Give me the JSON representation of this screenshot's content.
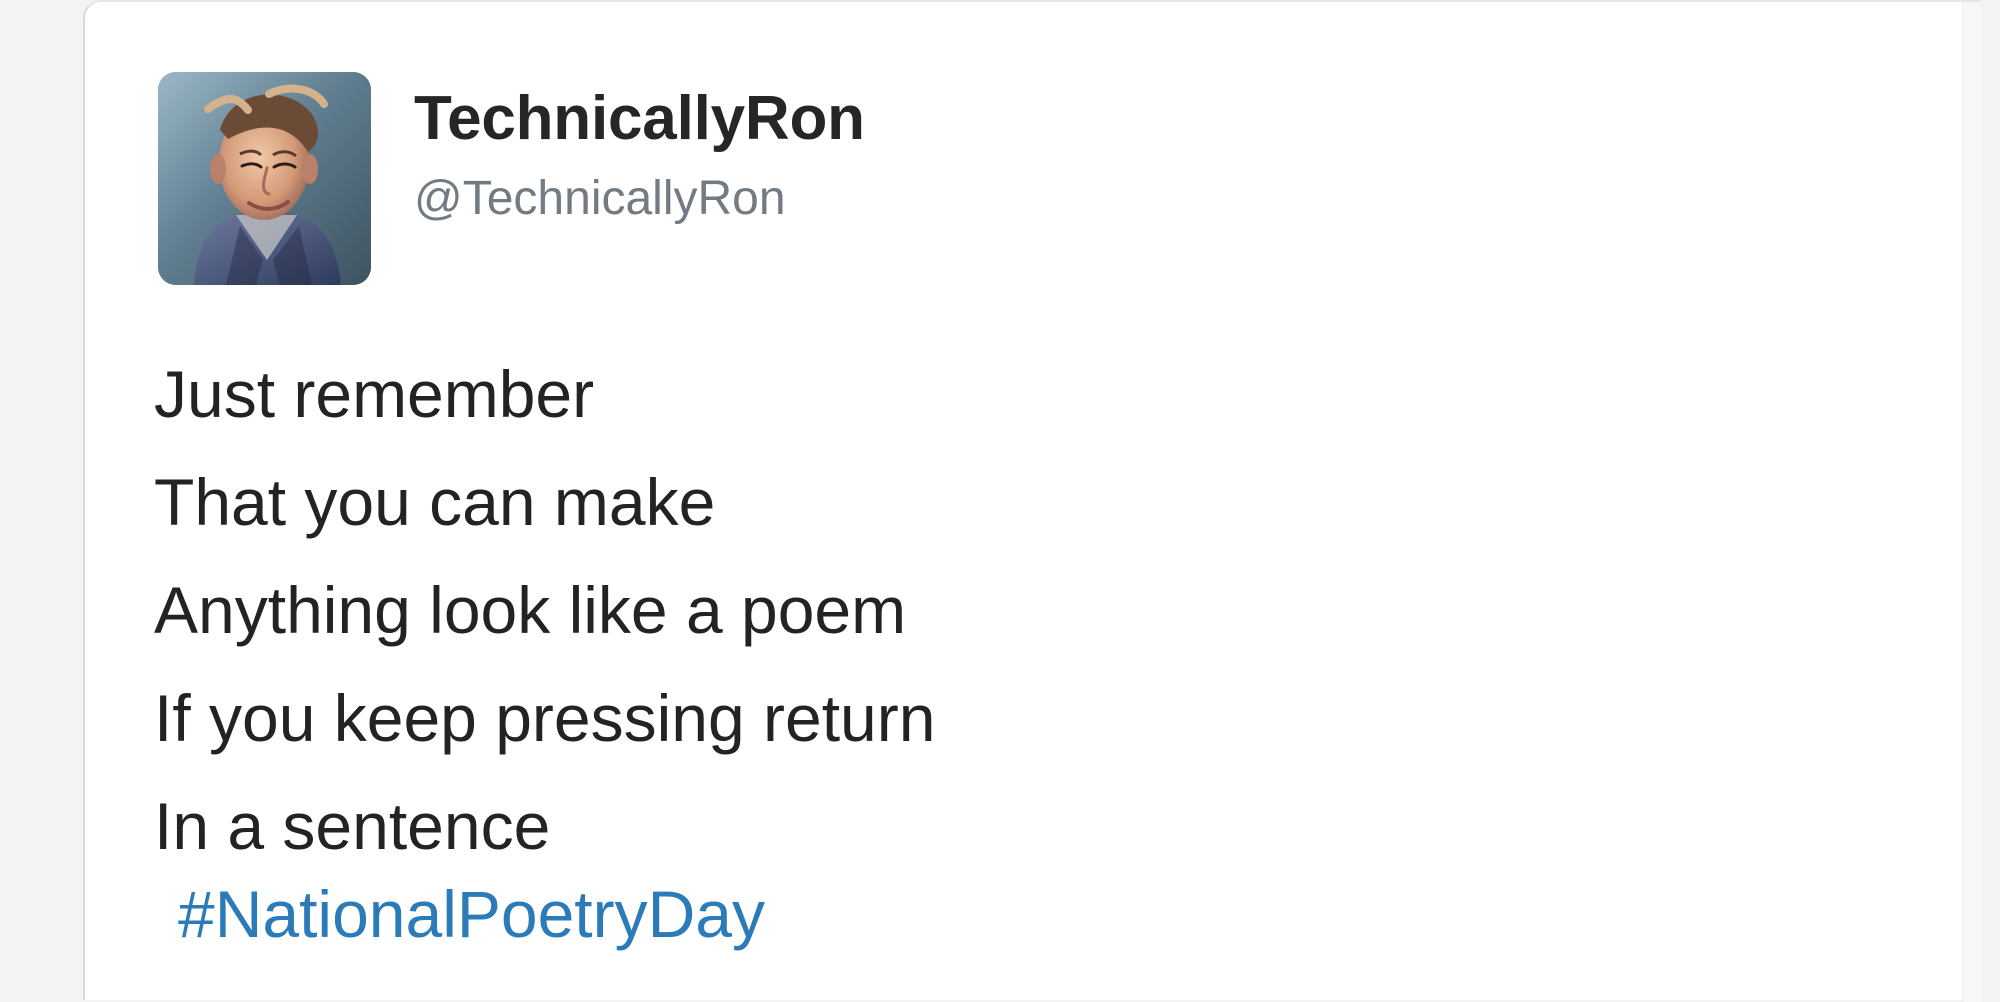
{
  "tweet": {
    "author": {
      "display_name": "TechnicallyRon",
      "username": "@TechnicallyRon",
      "avatar_icon": "illustrated-person-avatar"
    },
    "body_lines": [
      "Just remember",
      "That you can make",
      "Anything look like a poem",
      "If you keep pressing return",
      "In a sentence"
    ],
    "hashtag": "#NationalPoetryDay"
  },
  "colors": {
    "page_background": "#f3f3f3",
    "card_background": "#ffffff",
    "name_text": "#262626",
    "username_text": "#737b82",
    "body_text": "#232323",
    "hashtag": "#2b7bb9"
  }
}
